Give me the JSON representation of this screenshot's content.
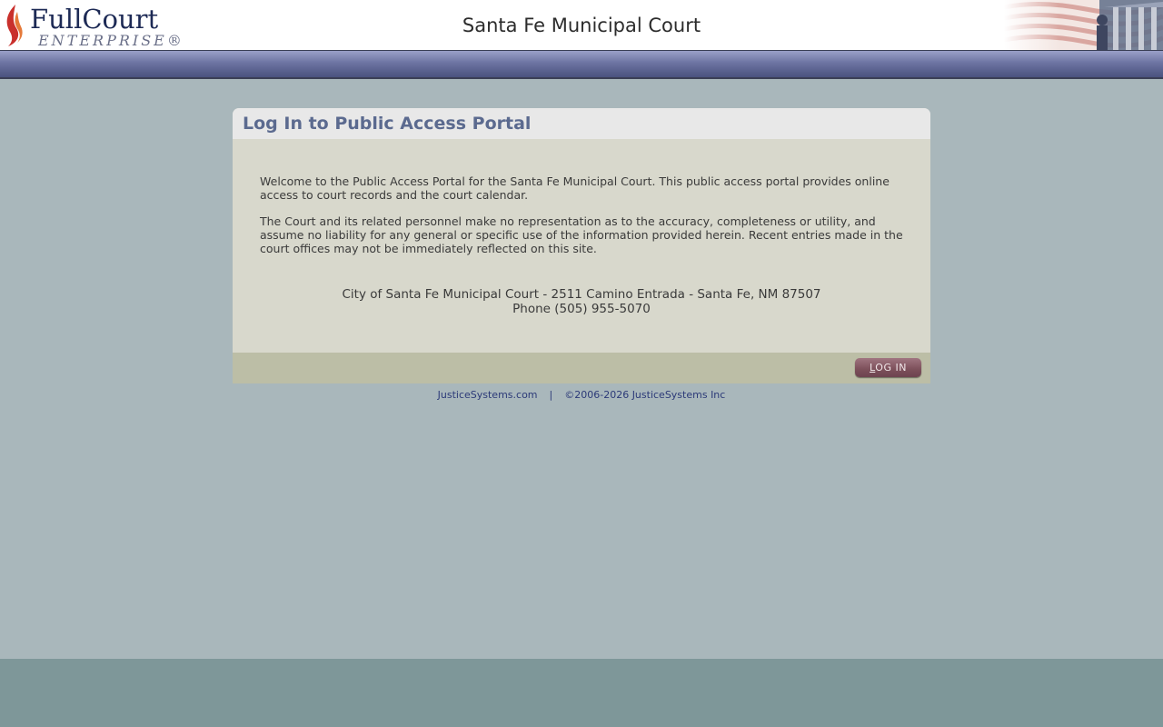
{
  "header": {
    "logo_line1": "FullCourt",
    "logo_line2": "ENTERPRISE®",
    "court_name": "Santa Fe Municipal Court"
  },
  "panel": {
    "title": "Log In to Public Access Portal",
    "paragraph1": "Welcome to the Public Access Portal for the Santa Fe Municipal Court. This public access portal provides online access to court records and the court calendar.",
    "paragraph2": "The Court and its related personnel make no representation as to the accuracy, completeness or utility, and assume no liability for any general or specific use of the information provided herein. Recent entries made in the court offices may not be immediately reflected on this site.",
    "address": "City of Santa Fe Municipal Court - 2511 Camino Entrada - Santa Fe, NM 87507",
    "phone": "Phone (505) 955-5070",
    "login_button_first": "L",
    "login_button_rest": "OG IN"
  },
  "footer": {
    "link": "JusticeSystems.com",
    "separator": "|",
    "copyright": "©2006-2026 JusticeSystems Inc"
  },
  "colors": {
    "background": "#a9b7bb",
    "nav_bar": "#6d74a2",
    "panel_body": "#d8d8cc",
    "panel_title": "#5b6a8f",
    "button": "#7c4f5a",
    "bottom_band": "#7e9799"
  },
  "icons": {
    "logo": "flame-logo-icon",
    "header_art": "flag-courthouse-icon"
  }
}
